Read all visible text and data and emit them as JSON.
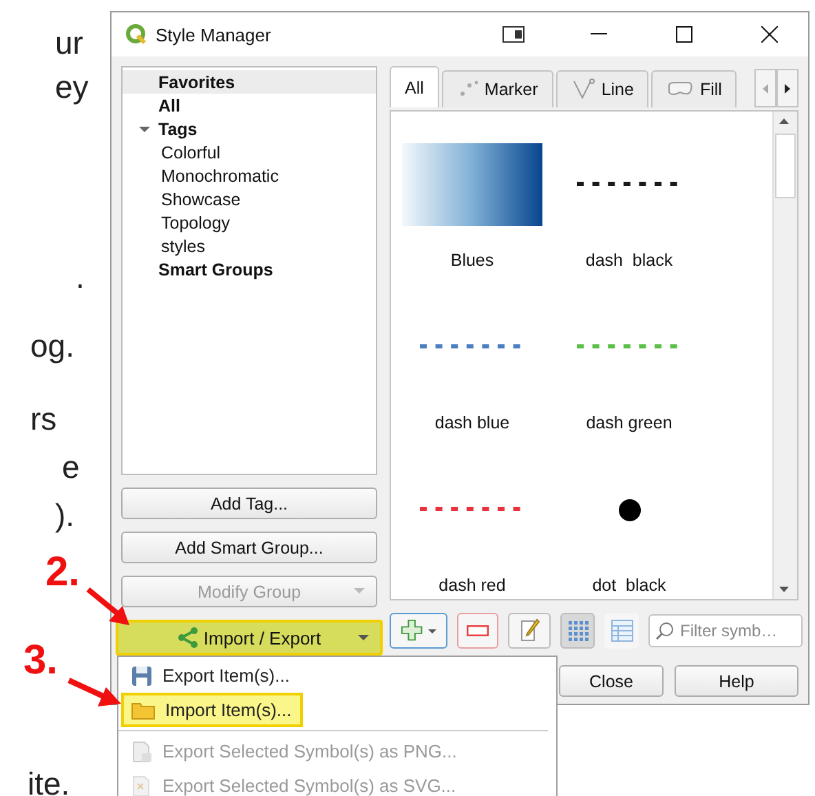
{
  "slide_text": [
    "ur",
    "ey",
    ".",
    "og.",
    "rs",
    "e",
    ").",
    "ite."
  ],
  "window": {
    "title": "Style Manager"
  },
  "tree": [
    {
      "label": "Favorites",
      "selected": true
    },
    {
      "label": "All",
      "selected": false
    },
    {
      "label": "Tags",
      "selected": false,
      "expanded": true,
      "children": [
        {
          "label": "Colorful",
          "selected": false
        },
        {
          "label": "Monochromatic",
          "selected": false
        },
        {
          "label": "Showcase",
          "selected": false
        },
        {
          "label": "Topology",
          "selected": false
        },
        {
          "label": "styles",
          "selected": false
        }
      ]
    },
    {
      "label": "Smart Groups",
      "selected": false
    }
  ],
  "left_buttons": [
    {
      "label": "Add Tag...",
      "kind": "plain",
      "disabled": false
    },
    {
      "label": "Add Smart Group...",
      "kind": "plain",
      "disabled": false
    },
    {
      "label": "Modify Group",
      "kind": "dropdown",
      "disabled": true
    }
  ],
  "import_export": {
    "label": "Import / Export",
    "highlighted": true
  },
  "tabs": [
    {
      "label": "All",
      "kind": "all",
      "selected": true
    },
    {
      "label": "Marker",
      "kind": "marker",
      "selected": false
    },
    {
      "label": "Line",
      "kind": "line",
      "selected": false
    },
    {
      "label": "Fill",
      "kind": "fill",
      "selected": false
    }
  ],
  "symbols": [
    {
      "name": "Blues",
      "kind": "gradient",
      "color": "#08458f"
    },
    {
      "name": "dash  black",
      "kind": "dashed",
      "color": "#1a1a1a"
    },
    {
      "name": "dash blue",
      "kind": "dashed",
      "color": "#4a7fc1"
    },
    {
      "name": "dash green",
      "kind": "dashed",
      "color": "#5cbf4a"
    },
    {
      "name": "dash red",
      "kind": "dashed",
      "color": "#e8323c"
    },
    {
      "name": "dot  black",
      "kind": "dot",
      "color": "#000000"
    }
  ],
  "views": [
    {
      "kind": "grid",
      "selected": true
    },
    {
      "kind": "list",
      "selected": false
    }
  ],
  "filter": {
    "placeholder": "Filter symb…"
  },
  "buttons": [
    "Close",
    "Help"
  ],
  "menu": {
    "groups": [
      [
        {
          "label": "Export Item(s)...",
          "kind": "save",
          "disabled": false,
          "highlighted": false
        },
        {
          "label": "Import Item(s)...",
          "kind": "folder",
          "disabled": false,
          "highlighted": true
        }
      ],
      [
        {
          "label": "Export Selected Symbol(s) as PNG...",
          "kind": "png",
          "disabled": true,
          "highlighted": false
        },
        {
          "label": "Export Selected Symbol(s) as SVG...",
          "kind": "svg",
          "disabled": true,
          "highlighted": false
        }
      ]
    ]
  },
  "steps": [
    "2.",
    "3."
  ]
}
